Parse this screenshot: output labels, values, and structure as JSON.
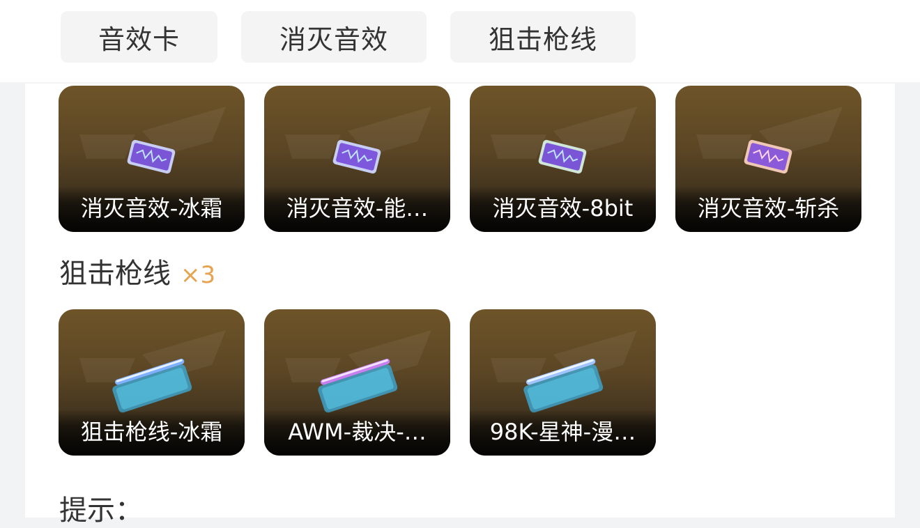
{
  "tabs": [
    {
      "label": "音效卡"
    },
    {
      "label": "消灭音效"
    },
    {
      "label": "狙击枪线"
    }
  ],
  "elimination_sounds": {
    "items": [
      {
        "label": "消灭音效-冰霜",
        "icon": "sound-card-icon"
      },
      {
        "label": "消灭音效-能…",
        "icon": "sound-card-icon"
      },
      {
        "label": "消灭音效-8bit",
        "icon": "sound-card-icon"
      },
      {
        "label": "消灭音效-斩杀",
        "icon": "sound-card-icon"
      }
    ]
  },
  "sniper_lines": {
    "title": "狙击枪线",
    "count": "×3",
    "items": [
      {
        "label": "狙击枪线-冰霜",
        "icon": "sniper-line-icon",
        "accent": "#7fb0ff"
      },
      {
        "label": "AWM-裁决-…",
        "icon": "sniper-line-icon",
        "accent": "#d38cff"
      },
      {
        "label": "98K-星神-漫…",
        "icon": "sniper-line-icon",
        "accent": "#9fc4ff"
      }
    ]
  },
  "tips": {
    "title": "提示："
  },
  "colors": {
    "count_accent": "#e6a350",
    "card_top": "#6e5428",
    "card_bottom": "#262019"
  }
}
